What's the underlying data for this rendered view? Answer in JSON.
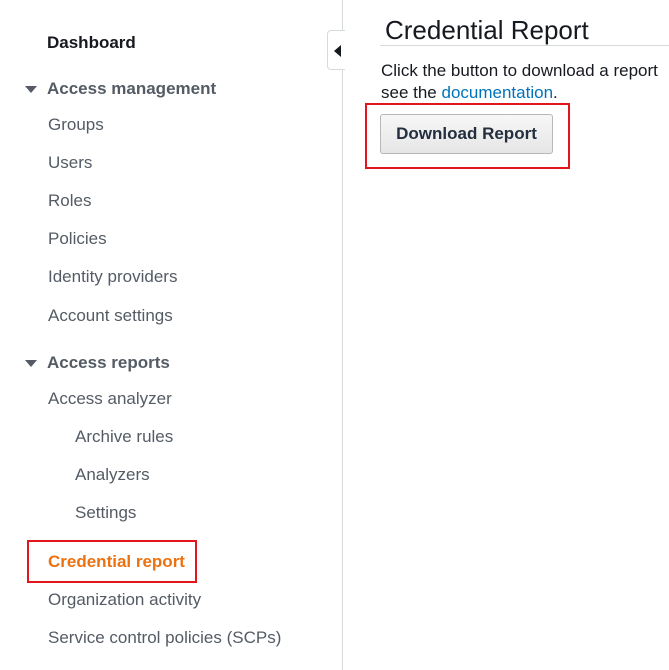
{
  "sidebar": {
    "dashboard": "Dashboard",
    "access_management": {
      "heading": "Access management",
      "items": [
        "Groups",
        "Users",
        "Roles",
        "Policies",
        "Identity providers",
        "Account settings"
      ]
    },
    "access_reports": {
      "heading": "Access reports",
      "access_analyzer": "Access analyzer",
      "analyzer_items": [
        "Archive rules",
        "Analyzers",
        "Settings"
      ],
      "credential_report": "Credential report",
      "organization_activity": "Organization activity",
      "scps": "Service control policies (SCPs)"
    }
  },
  "main": {
    "title": "Credential Report",
    "description_line1": "Click the button to download a report",
    "description_see": "see the",
    "documentation_link": "documentation",
    "period": ".",
    "download_button": "Download Report"
  },
  "colors": {
    "active_nav": "#ec7211",
    "link": "#0073bb",
    "highlight": "#e2141c"
  }
}
